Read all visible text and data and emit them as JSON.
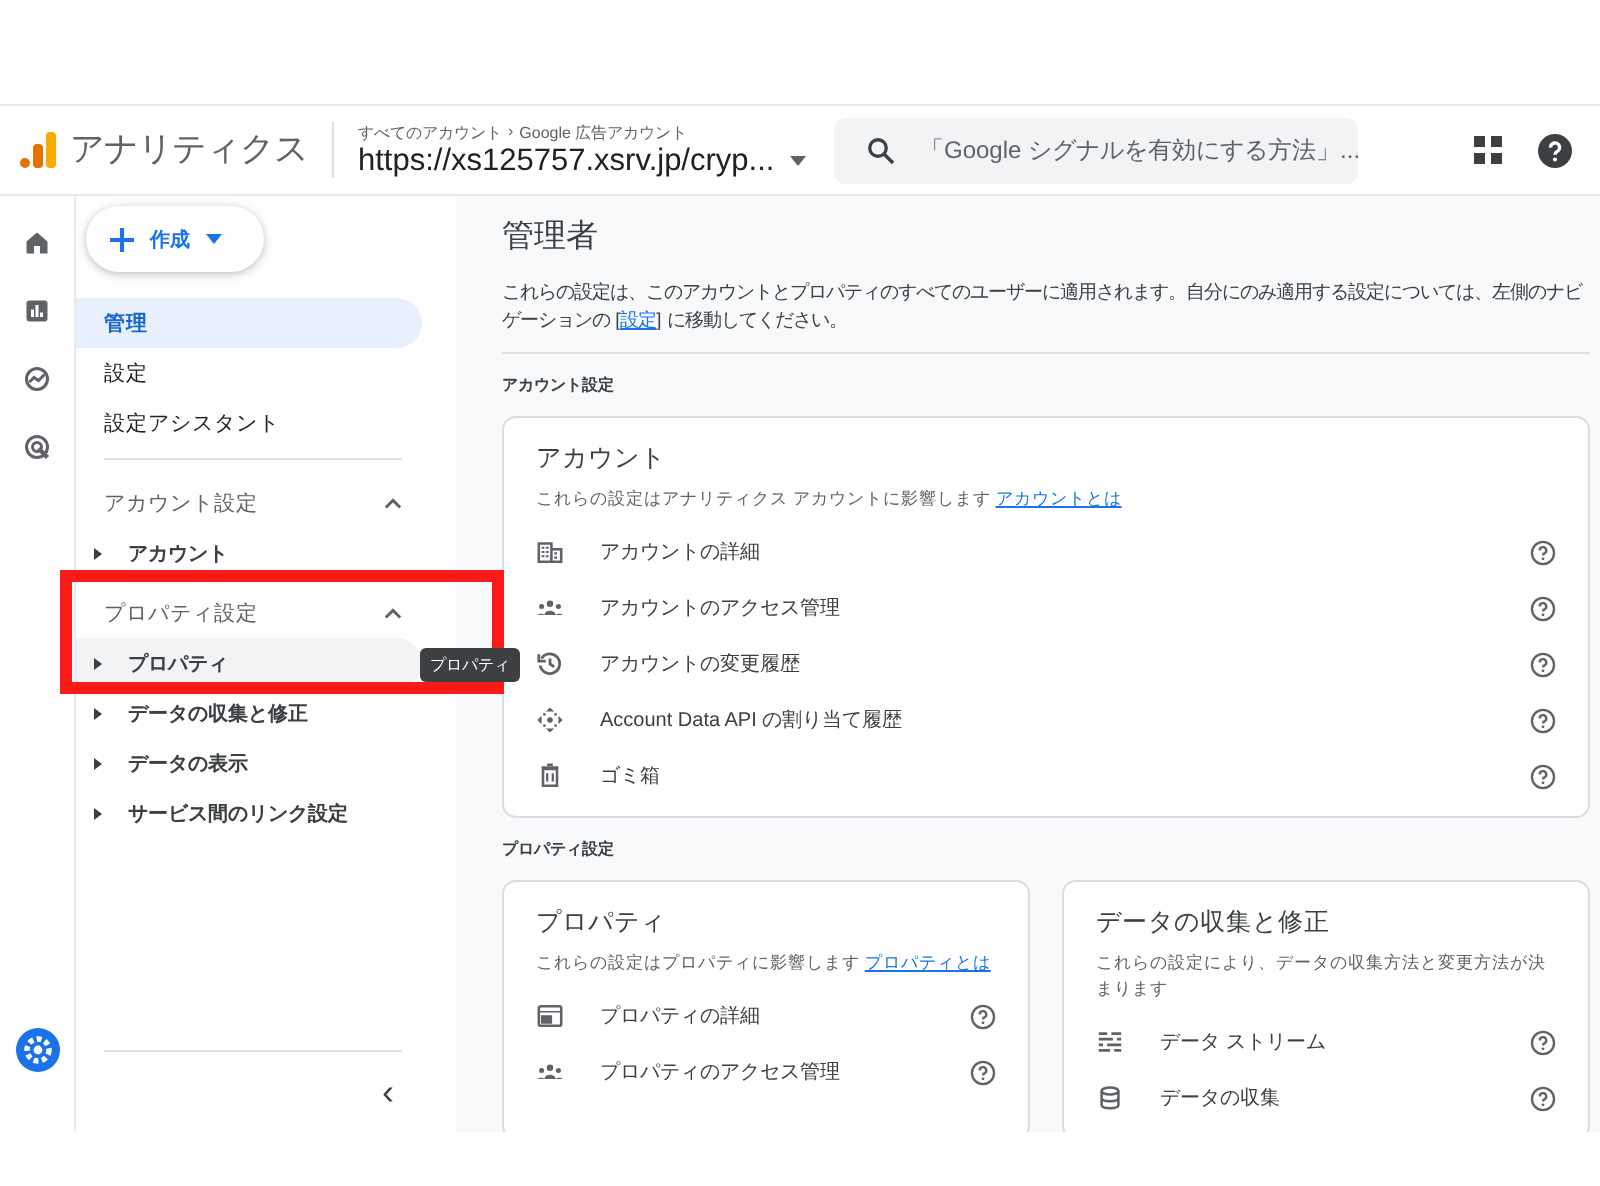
{
  "header": {
    "product": "アナリティクス",
    "breadcrumbs": [
      "すべてのアカウント",
      "Google 広告アカウント"
    ],
    "breadcrumb_separator": "›",
    "property": "https://xs125757.xsrv.jp/cryp...",
    "search": {
      "placeholder": "「Google シグナルを有効にする方法」..."
    }
  },
  "rail": [
    {
      "kind": "home",
      "selected": false
    },
    {
      "kind": "reports",
      "selected": false
    },
    {
      "kind": "explore",
      "selected": false
    },
    {
      "kind": "advertising",
      "selected": false
    },
    {
      "kind": "admin",
      "selected": true
    }
  ],
  "nav": {
    "create_button": "作成",
    "collapse": "‹",
    "items": [
      {
        "label": "管理",
        "selected": true
      },
      {
        "label": "設定",
        "selected": false
      },
      {
        "label": "設定アシスタント",
        "selected": false
      }
    ],
    "sections": [
      {
        "title": "アカウント設定",
        "expanded": true,
        "items": [
          {
            "label": "アカウント",
            "hovered": false
          }
        ]
      },
      {
        "title": "プロパティ設定",
        "expanded": true,
        "highlighted": true,
        "items": [
          {
            "label": "プロパティ",
            "hovered": true,
            "tooltip": "プロパティ"
          },
          {
            "label": "データの収集と修正",
            "hovered": false
          },
          {
            "label": "データの表示",
            "hovered": false
          },
          {
            "label": "サービス間のリンク設定",
            "hovered": false
          }
        ]
      }
    ]
  },
  "main": {
    "title": "管理者",
    "description": {
      "before": "これらの設定は、このアカウントとプロパティのすべてのユーザーに適用されます。自分にのみ適用する設定については、左側のナビゲーションの [",
      "link": "設定",
      "after": "] に移動してください。"
    },
    "sections": [
      {
        "heading": "アカウント設定",
        "cards": [
          {
            "title": "アカウント",
            "description": "これらの設定はアナリティクス アカウントに影響します",
            "link": "アカウントとは",
            "rows": [
              {
                "kind": "building",
                "label": "アカウントの詳細"
              },
              {
                "kind": "people",
                "label": "アカウントのアクセス管理"
              },
              {
                "kind": "history",
                "label": "アカウントの変更履歴"
              },
              {
                "kind": "api",
                "label": "Account Data API の割り当て履歴"
              },
              {
                "kind": "trash",
                "label": "ゴミ箱"
              }
            ]
          }
        ]
      },
      {
        "heading": "プロパティ設定",
        "cards": [
          {
            "title": "プロパティ",
            "description": "これらの設定はプロパティに影響します",
            "link": "プロパティとは",
            "rows": [
              {
                "kind": "panel",
                "label": "プロパティの詳細"
              },
              {
                "kind": "people",
                "label": "プロパティのアクセス管理"
              }
            ]
          },
          {
            "title": "データの収集と修正",
            "description": "これらの設定により、データの収集方法と変更方法が決まります",
            "rows": [
              {
                "kind": "stream",
                "label": "データ ストリーム"
              },
              {
                "kind": "database",
                "label": "データの収集"
              }
            ]
          }
        ]
      }
    ]
  }
}
